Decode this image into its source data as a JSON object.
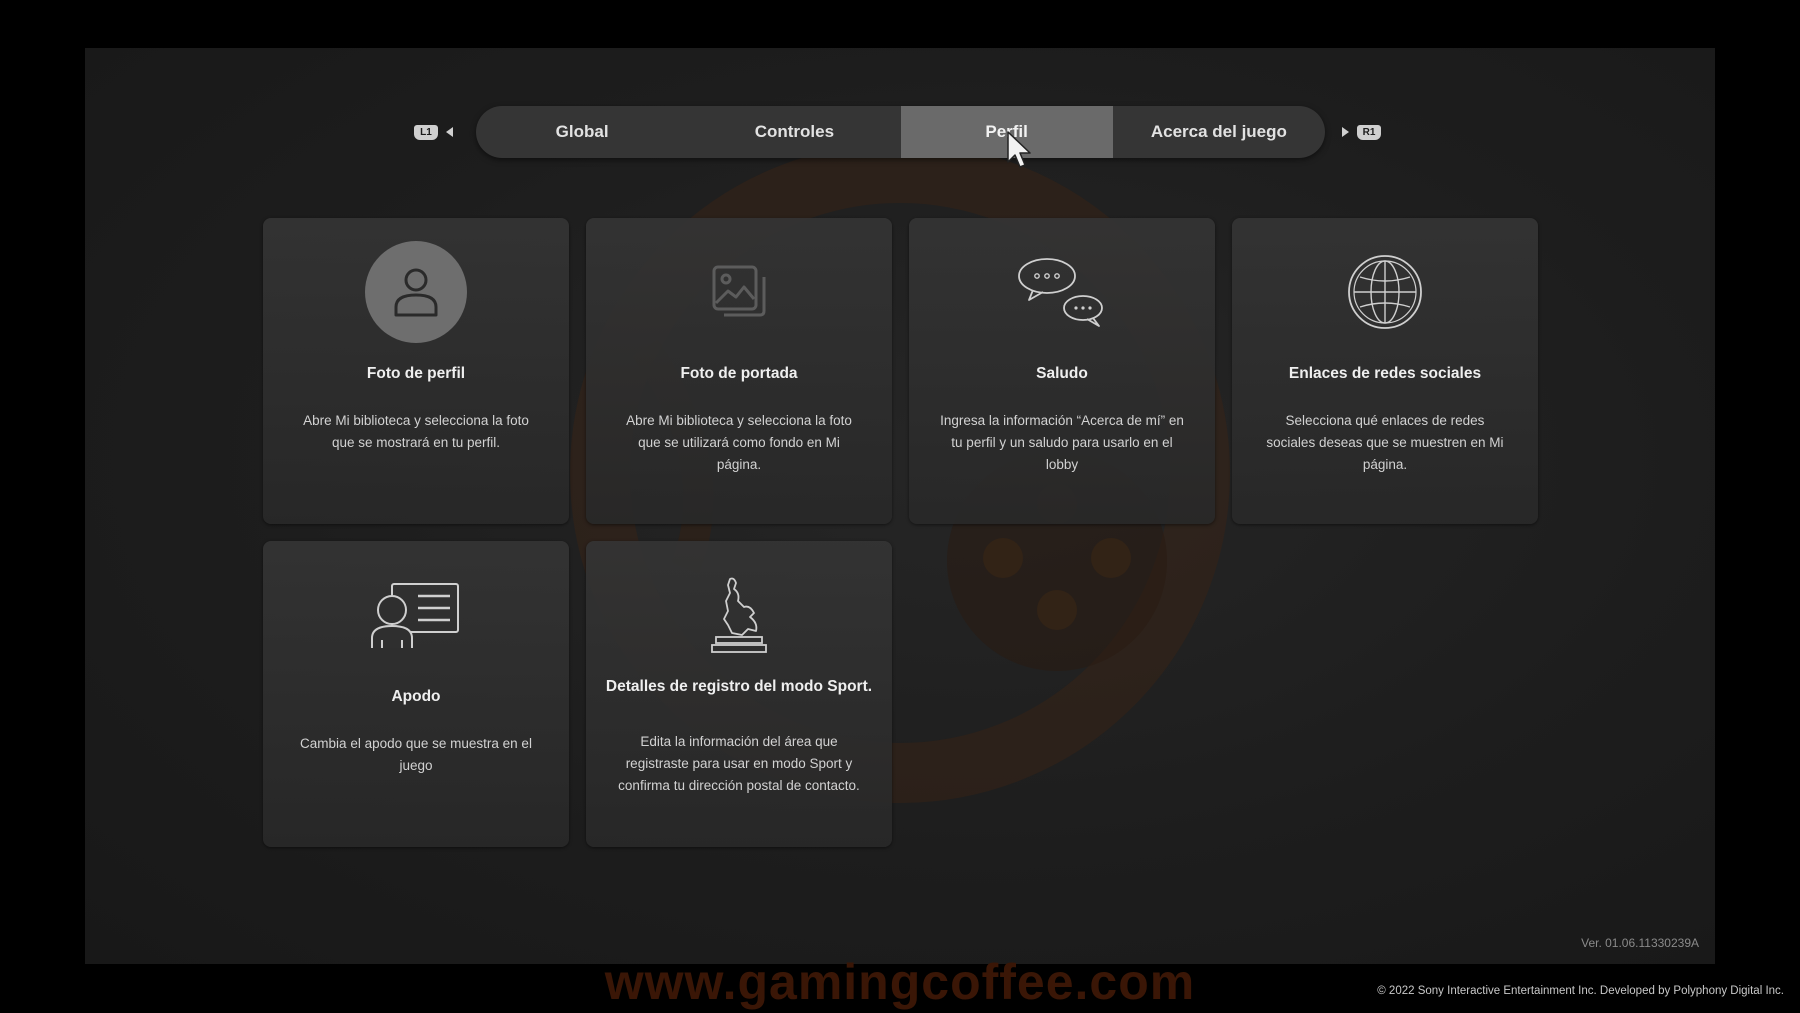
{
  "tabs": {
    "left_shoulder": "L1",
    "right_shoulder": "R1",
    "items": [
      {
        "label": "Global"
      },
      {
        "label": "Controles"
      },
      {
        "label": "Perfil",
        "active": true
      },
      {
        "label": "Acerca del juego"
      }
    ]
  },
  "cards": [
    {
      "icon": "user-icon",
      "title": "Foto de perfil",
      "description": "Abre Mi biblioteca y selecciona la foto que se mostrará en tu perfil."
    },
    {
      "icon": "image-gallery-icon",
      "title": "Foto de portada",
      "description": "Abre Mi biblioteca y selecciona la foto que se utilizará como fondo en Mi página."
    },
    {
      "icon": "chat-bubbles-icon",
      "title": "Saludo",
      "description": "Ingresa la información “Acerca de mí” en tu perfil y un saludo para usarlo en el lobby"
    },
    {
      "icon": "globe-icon",
      "title": "Enlaces de redes sociales",
      "description": "Selecciona qué enlaces de redes sociales deseas que se muestren en Mi página."
    },
    {
      "icon": "id-card-icon",
      "title": "Apodo",
      "description": "Cambia el apodo que se muestra en el juego"
    },
    {
      "icon": "trophy-statue-icon",
      "title": "Detalles de registro del modo Sport.",
      "description": "Edita la información del área que registraste para usar en modo Sport y confirma tu dirección postal de contacto."
    }
  ],
  "version": "Ver. 01.06.11330239A",
  "copyright": "© 2022 Sony Interactive Entertainment Inc. Developed by Polyphony Digital Inc.",
  "watermark": "www.gamingcoffee.com",
  "colors": {
    "background": "#000000",
    "panel": "#1d1d1d",
    "card": "#2f2f2f",
    "tab_bar": "#353535",
    "tab_active": "#6a6a6a",
    "text": "#e4e4e4",
    "watermark": "#3a1606"
  }
}
